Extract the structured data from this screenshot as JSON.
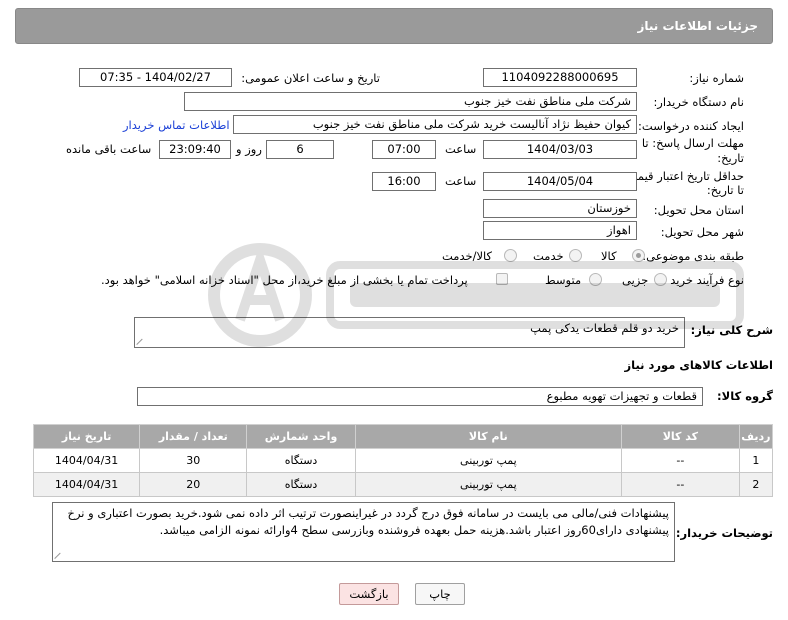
{
  "panel": {
    "title": "جزئیات اطلاعات نیاز"
  },
  "form": {
    "need_number": {
      "label": "شماره نیاز:",
      "value": "1104092288000695"
    },
    "announce_datetime": {
      "label": "تاریخ و ساعت اعلان عمومی:",
      "value": "1404/02/27 - 07:35"
    },
    "buyer_org": {
      "label": "نام دستگاه خریدار:",
      "value": "شرکت ملی مناطق نفت خیز جنوب"
    },
    "requester": {
      "label": "ایجاد کننده درخواست:",
      "value": "کیوان حفیظ نژاد آنالیست خرید شرکت ملی مناطق نفت خیز جنوب",
      "contact_link": "اطلاعات تماس خریدار"
    },
    "reply_deadline": {
      "label_line1": "مهلت ارسال پاسخ: تا",
      "label_line2": "تاریخ:",
      "date": "1404/03/03",
      "time_label": "ساعت",
      "time": "07:00",
      "days": "6",
      "days_label": "روز و",
      "remaining": "23:09:40",
      "remaining_label": "ساعت باقی مانده"
    },
    "price_validity": {
      "label_line1": "حداقل تاریخ اعتبار قیمت:",
      "label_line2": "تا تاریخ:",
      "date": "1404/05/04",
      "time_label": "ساعت",
      "time": "16:00"
    },
    "province": {
      "label": "استان محل تحویل:",
      "value": "خوزستان"
    },
    "city": {
      "label": "شهر محل تحویل:",
      "value": "اهواز"
    },
    "category": {
      "label": "طبقه بندی موضوعی:",
      "options": [
        "کالا",
        "خدمت",
        "کالا/خدمت"
      ],
      "selected": "کالا"
    },
    "purchase_type": {
      "label": "نوع فرآیند خرید :",
      "options": [
        "جزیی",
        "متوسط"
      ],
      "payment_note": "پرداخت تمام یا بخشی از مبلغ خرید،از محل \"اسناد خزانه اسلامی\" خواهد بود."
    }
  },
  "description": {
    "label": "شرح کلی نیاز:",
    "value": "خرید دو قلم قطعات یدکی پمپ"
  },
  "goods_section": {
    "title": "اطلاعات کالاهای مورد نیاز",
    "group_label": "گروه کالا:",
    "group_value": "قطعات و تجهیزات تهویه مطبوع"
  },
  "items_table": {
    "headers": [
      "ردیف",
      "کد کالا",
      "نام کالا",
      "واحد شمارش",
      "تعداد / مقدار",
      "تاریخ نیاز"
    ],
    "rows": [
      [
        "1",
        "--",
        "پمپ توربینی",
        "دستگاه",
        "30",
        "1404/04/31"
      ],
      [
        "2",
        "--",
        "پمپ توربینی",
        "دستگاه",
        "20",
        "1404/04/31"
      ]
    ]
  },
  "buyer_notes": {
    "label": "توضیحات خریدار:",
    "value": "پیشنهادات فنی/مالی می بایست در سامانه فوق درج گردد در غیراینصورت ترتیب اثر داده نمی شود.خرید بصورت اعتباری و نرخ پیشنهادی دارای60روز اعتبار باشد.هزینه حمل بعهده فروشنده وبازرسی سطح 4وارائه نمونه الزامی میباشد."
  },
  "buttons": {
    "print": "چاپ",
    "back": "بازگشت"
  },
  "colors": {
    "header_bg": "#9a9a9a",
    "table_header_bg": "#a8a8a8",
    "link": "#1a3fd6",
    "back_button_bg": "#fbe3e3"
  }
}
